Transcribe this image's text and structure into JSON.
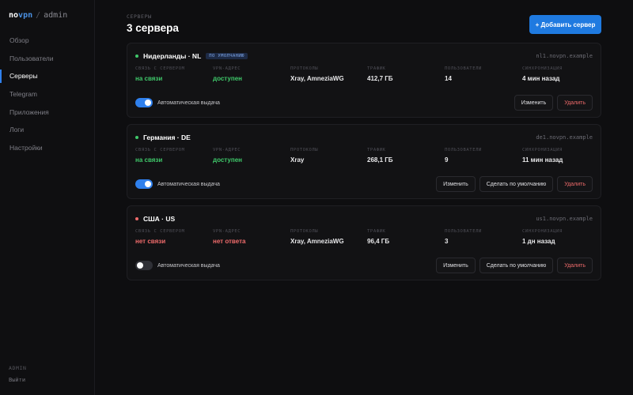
{
  "app": {
    "brand_a": "no",
    "brand_b": "vpn",
    "separator": "/",
    "sub": "admin"
  },
  "nav": [
    {
      "label": "Обзор",
      "active": false
    },
    {
      "label": "Пользователи",
      "active": false
    },
    {
      "label": "Серверы",
      "active": true
    },
    {
      "label": "Telegram",
      "active": false
    },
    {
      "label": "Приложения",
      "active": false
    },
    {
      "label": "Логи",
      "active": false
    },
    {
      "label": "Настройки",
      "active": false
    }
  ],
  "footer": {
    "role": "ADMIN",
    "logout": "Выйти"
  },
  "header": {
    "section": "СЕРВЕРЫ",
    "title": "3 сервера",
    "add_button": "+ Добавить сервер"
  },
  "colors": {
    "accent": "#2f80ed",
    "online": "#3fc86a",
    "offline": "#ef6b6b"
  },
  "labels": {
    "connection": "СВЯЗЬ С СЕРВЕРОМ",
    "vpn": "VPN-АДРЕС",
    "protocols": "ПРОТОКОЛЫ",
    "traffic": "ТРАФИК",
    "users": "ПОЛЬЗОВАТЕЛИ",
    "sync": "СИНХРОНИЗАЦИЯ",
    "auto": "Автоматическая выдача",
    "edit": "Изменить",
    "make_default": "Сделать по умолчанию",
    "delete": "Удалить"
  },
  "servers": [
    {
      "name": "Нидерланды · NL",
      "badge": "ПО УМОЛЧАНИЮ",
      "host": "nl1.novpn.example",
      "online": true,
      "connection": "на связи",
      "vpn": "доступен",
      "protocols": "Xray, AmneziaWG",
      "traffic": "412,7 ГБ",
      "users": "14",
      "sync": "4 мин назад",
      "auto": true,
      "is_default": true
    },
    {
      "name": "Германия · DE",
      "badge": "",
      "host": "de1.novpn.example",
      "online": true,
      "connection": "на связи",
      "vpn": "доступен",
      "protocols": "Xray",
      "traffic": "268,1 ГБ",
      "users": "9",
      "sync": "11 мин назад",
      "auto": true,
      "is_default": false
    },
    {
      "name": "США · US",
      "badge": "",
      "host": "us1.novpn.example",
      "online": false,
      "connection": "нет связи",
      "vpn": "нет ответа",
      "protocols": "Xray, AmneziaWG",
      "traffic": "96,4 ГБ",
      "users": "3",
      "sync": "1 дн назад",
      "auto": false,
      "is_default": false
    }
  ]
}
